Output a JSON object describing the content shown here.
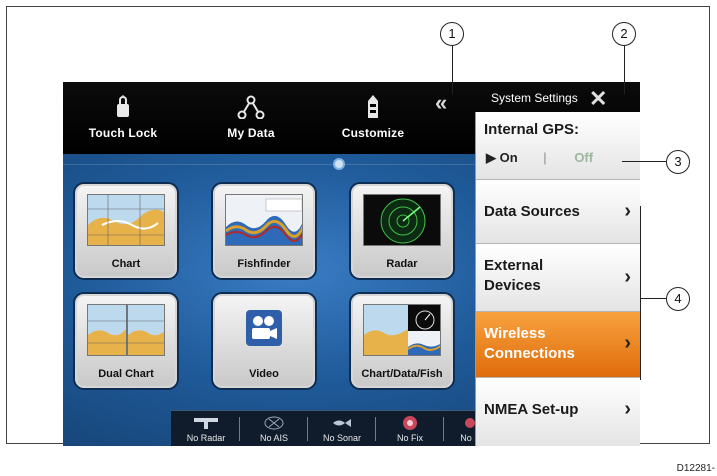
{
  "topbar": {
    "items": [
      {
        "label": "Touch Lock",
        "icon": "touch-lock-icon"
      },
      {
        "label": "My Data",
        "icon": "my-data-icon"
      },
      {
        "label": "Customize",
        "icon": "customize-icon"
      }
    ]
  },
  "apps": [
    {
      "label": "Chart",
      "icon": "chart-thumbnail"
    },
    {
      "label": "Fishfinder",
      "icon": "fishfinder-thumbnail"
    },
    {
      "label": "Radar",
      "icon": "radar-thumbnail"
    },
    {
      "label": "Dual Chart",
      "icon": "dual-chart-thumbnail"
    },
    {
      "label": "Video",
      "icon": "video-camera-icon"
    },
    {
      "label": "Chart/Data/Fish",
      "icon": "chart-data-fish-thumbnail"
    }
  ],
  "status_bar": {
    "items": [
      {
        "label": "No Radar",
        "icon": "radar-status-icon"
      },
      {
        "label": "No AIS",
        "icon": "ais-status-icon"
      },
      {
        "label": "No Sonar",
        "icon": "sonar-status-icon"
      },
      {
        "label": "No Fix",
        "icon": "gps-status-icon"
      },
      {
        "label": "No F",
        "icon": "status-icon"
      }
    ]
  },
  "settings": {
    "title": "System Settings",
    "internal_gps": {
      "label": "Internal GPS:",
      "on": "On",
      "separator": "|",
      "off": "Off",
      "selected": "On"
    },
    "items": [
      {
        "label": "Data Sources",
        "active": false
      },
      {
        "label": "External Devices",
        "active": false
      },
      {
        "label": "Wireless Connections",
        "active": true
      },
      {
        "label": "NMEA Set-up",
        "active": false
      }
    ]
  },
  "callouts": [
    "1",
    "2",
    "3",
    "4"
  ],
  "drawing_id": "D12281-",
  "colors": {
    "accent": "#e8790f",
    "screen_bg": "#1d4f86",
    "topbar_bg": "#000000"
  }
}
